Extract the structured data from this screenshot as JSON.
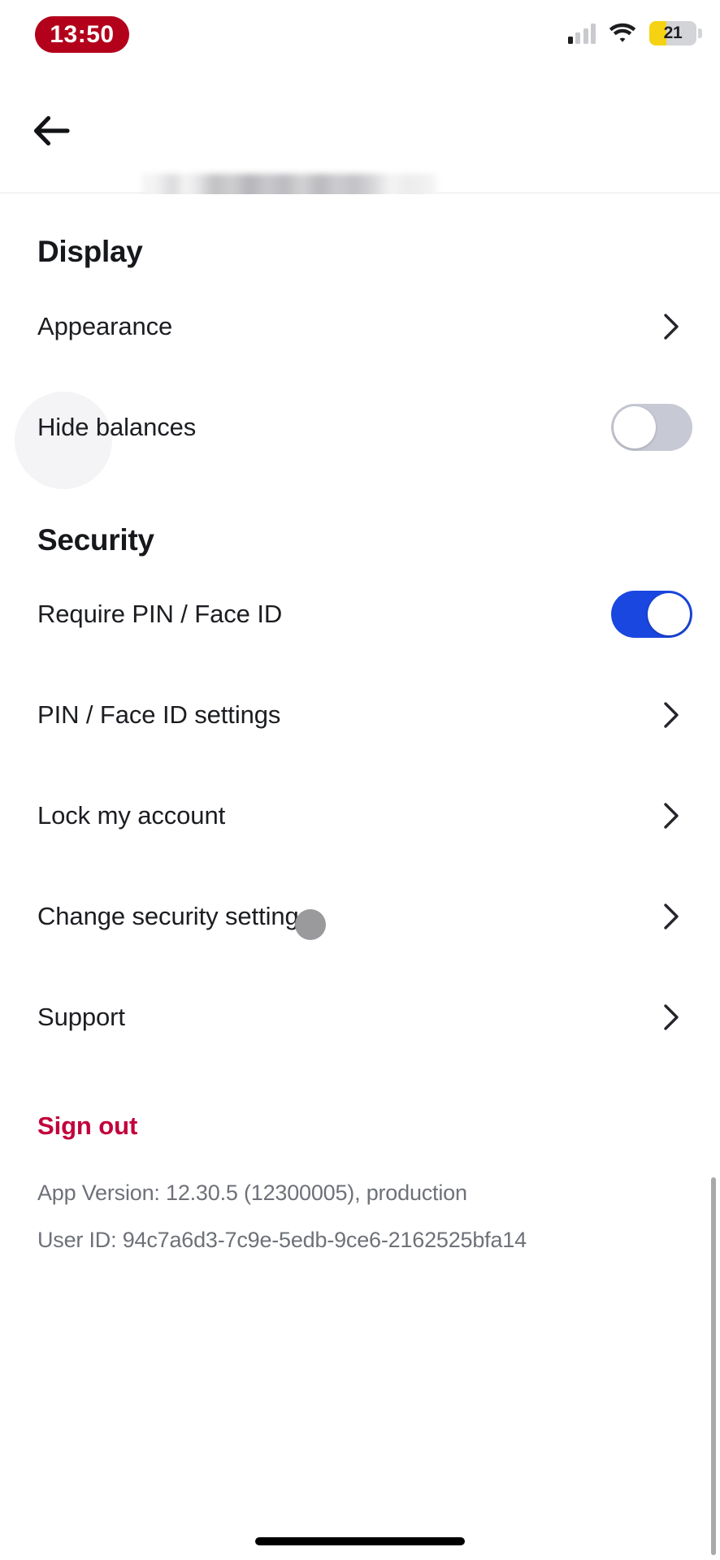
{
  "status_bar": {
    "time": "13:50",
    "time_badge_color": "#b3001b",
    "signal_icon": "cellular-signal-icon",
    "signal_bars_filled": 1,
    "signal_bars_total": 4,
    "wifi_icon": "wifi-icon",
    "battery_icon": "battery-icon",
    "battery_percent": "21",
    "battery_fill_color": "#f5d312"
  },
  "nav": {
    "back_icon": "back-arrow-icon",
    "title": "",
    "title_redacted": true
  },
  "sections": [
    {
      "title": "Display",
      "rows": [
        {
          "label": "Appearance",
          "control": "chevron"
        },
        {
          "label": "Hide balances",
          "control": "toggle",
          "toggle_state": "off"
        }
      ]
    },
    {
      "title": "Security",
      "rows": [
        {
          "label": "Require PIN / Face ID",
          "control": "toggle",
          "toggle_state": "on"
        },
        {
          "label": "PIN / Face ID settings",
          "control": "chevron"
        },
        {
          "label": "Lock my account",
          "control": "chevron"
        },
        {
          "label": "Change security settings",
          "control": "chevron"
        },
        {
          "label": "Support",
          "control": "chevron"
        }
      ]
    }
  ],
  "sign_out": {
    "label": "Sign out",
    "color": "#c2003b"
  },
  "footer": {
    "app_version": "App Version: 12.30.5 (12300005), production",
    "user_id": "User ID: 94c7a6d3-7c9e-5edb-9ce6-2162525bfa14"
  },
  "colors": {
    "toggle_on": "#1a47e0",
    "toggle_off": "#c7c9d4",
    "accent_red": "#c2003b",
    "text_primary": "#1b1d21",
    "text_muted": "#6e7178"
  }
}
